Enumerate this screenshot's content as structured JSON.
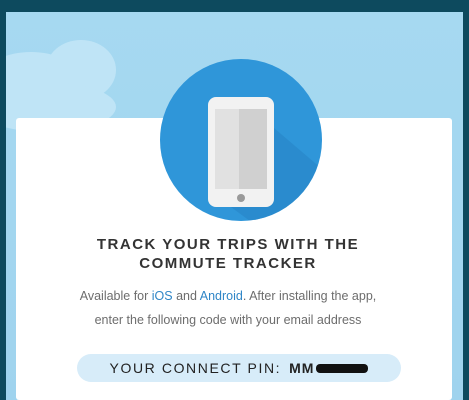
{
  "card": {
    "title_line1": "TRACK YOUR TRIPS WITH THE",
    "title_line2": "COMMUTE TRACKER",
    "desc_available": "Available for ",
    "desc_ios": "iOS",
    "desc_and": " and ",
    "desc_android": "Android",
    "desc_after": ". After installing the app,",
    "desc_line2": "enter the following code with your email address",
    "pin_label": "YOUR CONNECT PIN:",
    "pin_value_visible": "MM"
  },
  "colors": {
    "background": "#0d4a5e",
    "sky": "#9fd4ef",
    "accent": "#2f96d9",
    "link": "#2f86c7",
    "pin_pill": "#d7ecf9"
  },
  "icons": {
    "hero": "smartphone-icon"
  }
}
